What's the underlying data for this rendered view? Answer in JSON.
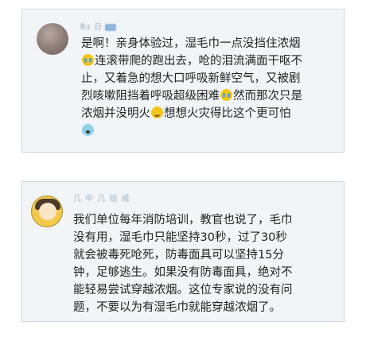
{
  "comments": [
    {
      "username": "ฟัง 日",
      "lines": [
        "是啊！亲身体验过，湿毛巾一点没挡住浓烟",
        "连滚带爬的跑出去，呛的泪流满面干呕不",
        "止，又着急的想大口呼吸新鲜空气，又被剧",
        "烈咳嗽阻挡着呼吸超级困难",
        "然而那次只是",
        "浓烟并没明火",
        "想想火灾得比这个更可怕"
      ],
      "emojis": [
        "crying-emoji",
        "crying-emoji",
        "smile-emoji",
        "fear-emoji"
      ]
    },
    {
      "username": "几 中 几 组 成",
      "lines": [
        "我们单位每年消防培训，教官也说了，毛巾",
        "没有用，湿毛巾只能坚持30秒，过了30秒",
        "就会被毒死呛死，防毒面具可以坚持15分",
        "钟，足够逃生。如果没有防毒面具，绝对不",
        "能轻易尝试穿越浓烟。这位专家说的没有问",
        "题，不要以为有湿毛巾就能穿越浓烟了。"
      ]
    }
  ]
}
